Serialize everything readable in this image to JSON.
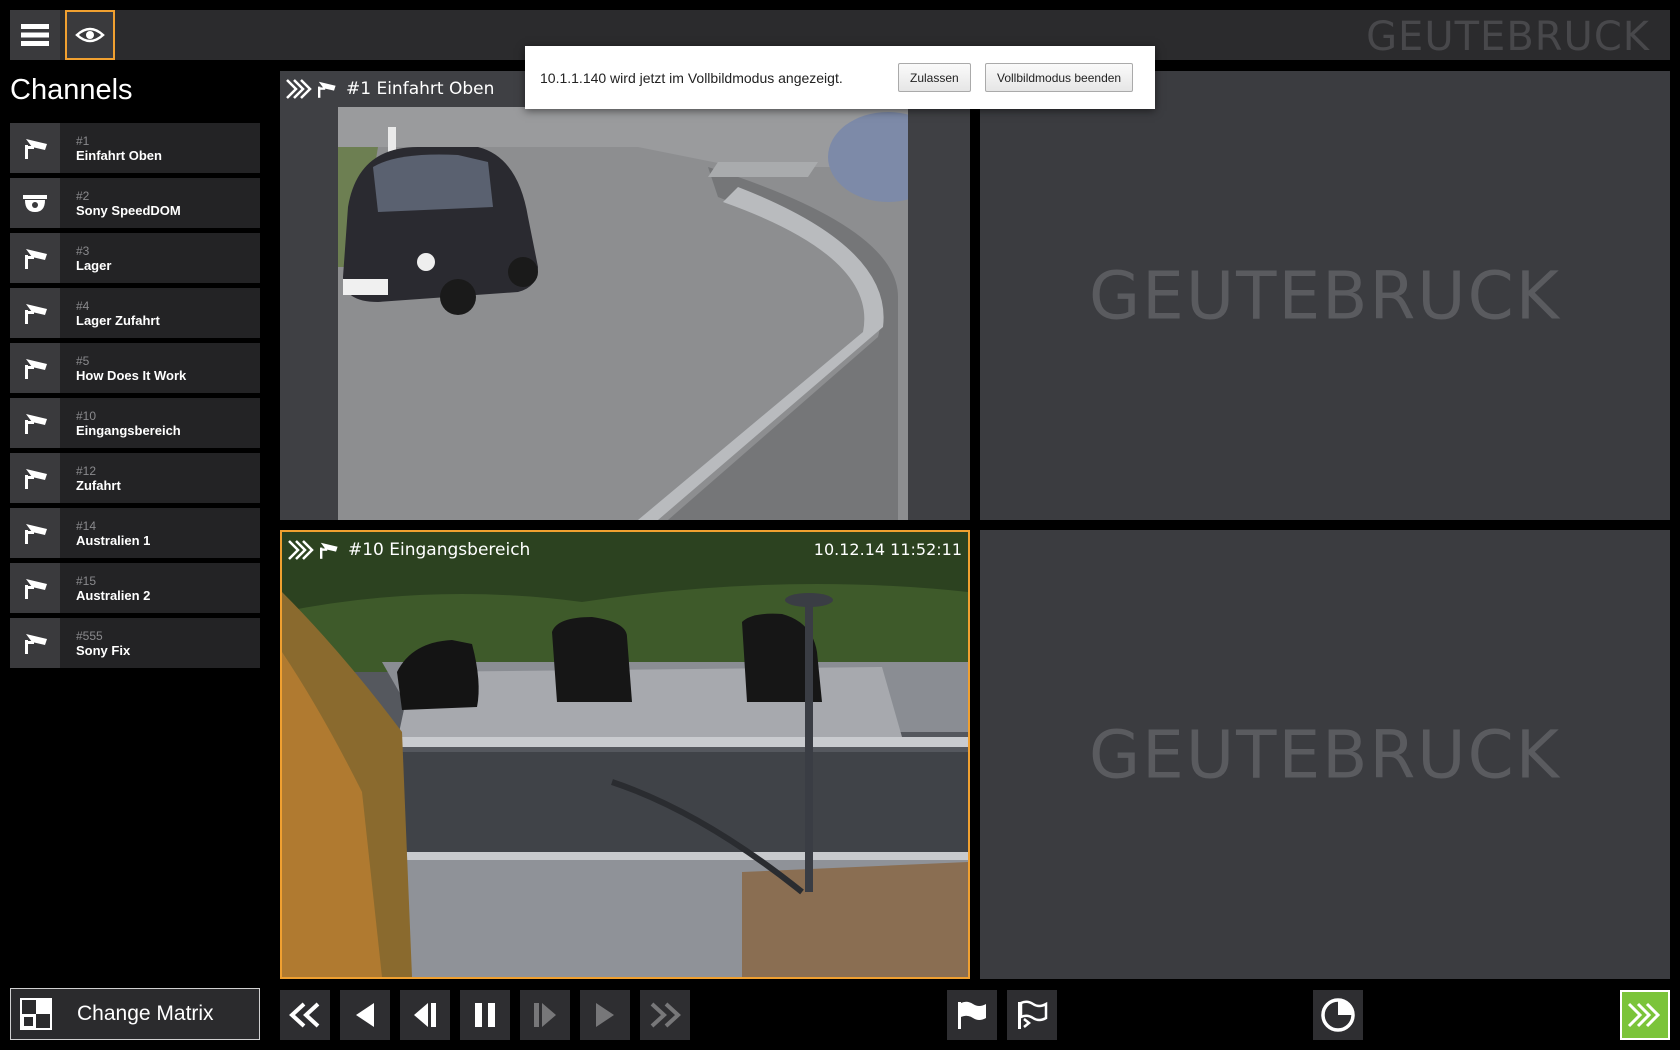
{
  "header": {
    "brand": "GEUTEBRUCK",
    "menu_icon": "hamburger-icon",
    "view_icon": "eye-icon",
    "accent_color": "#f0a030"
  },
  "popup": {
    "message": "10.1.1.140 wird jetzt im Vollbildmodus angezeigt.",
    "allow_label": "Zulassen",
    "exit_label": "Vollbildmodus beenden"
  },
  "sidebar": {
    "title": "Channels",
    "items": [
      {
        "num": "#1",
        "name": "Einfahrt Oben",
        "icon": "camera-icon"
      },
      {
        "num": "#2",
        "name": "Sony SpeedDOM",
        "icon": "dome-camera-icon"
      },
      {
        "num": "#3",
        "name": "Lager",
        "icon": "camera-icon"
      },
      {
        "num": "#4",
        "name": "Lager Zufahrt",
        "icon": "camera-icon"
      },
      {
        "num": "#5",
        "name": "How Does It Work",
        "icon": "camera-icon"
      },
      {
        "num": "#10",
        "name": "Eingangsbereich",
        "icon": "camera-icon"
      },
      {
        "num": "#12",
        "name": "Zufahrt",
        "icon": "camera-icon"
      },
      {
        "num": "#14",
        "name": "Australien 1",
        "icon": "camera-icon"
      },
      {
        "num": "#15",
        "name": "Australien 2",
        "icon": "camera-icon"
      },
      {
        "num": "#555",
        "name": "Sony Fix",
        "icon": "camera-icon"
      }
    ],
    "change_matrix_label": "Change Matrix"
  },
  "tiles": {
    "t1": {
      "title": "#1  Einfahrt Oben"
    },
    "t2": {
      "brand": "GEUTEBRUCK"
    },
    "t3": {
      "title": "#10  Eingangsbereich",
      "timestamp": "10.12.14 11:52:11"
    },
    "t4": {
      "brand": "GEUTEBRUCK"
    }
  },
  "controls": {
    "live_color": "#7bc43a"
  }
}
